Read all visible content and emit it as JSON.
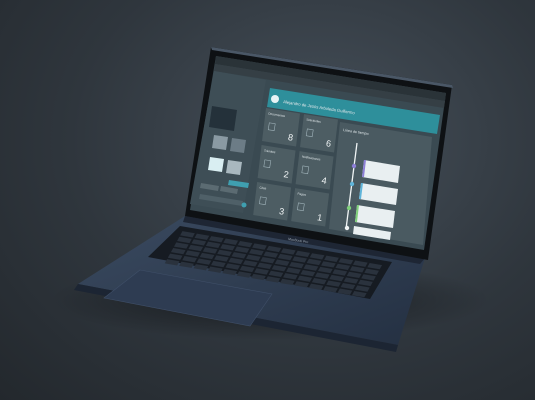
{
  "device": {
    "brand_label": "MacBook Pro"
  },
  "browser": {
    "title_bar": "Alejandro de Jesús Arboleda Guillermo"
  },
  "dashboard": {
    "tiles": [
      {
        "label": "Documentos",
        "value": "8"
      },
      {
        "label": "Solicitudes",
        "value": "6"
      },
      {
        "label": "Trámites",
        "value": "2"
      },
      {
        "label": "Notificaciones",
        "value": "4"
      },
      {
        "label": "Citas",
        "value": "3"
      },
      {
        "label": "Pagos",
        "value": "1"
      }
    ],
    "timeline_title": "Línea de tiempo"
  },
  "colors": {
    "screen_bg": "#3a4a52",
    "accent_teal": "#2e8f9b",
    "tile_bg": "#4d5d63",
    "laptop_body": "#2c3a4d",
    "keyboard": "#1a1f26"
  }
}
